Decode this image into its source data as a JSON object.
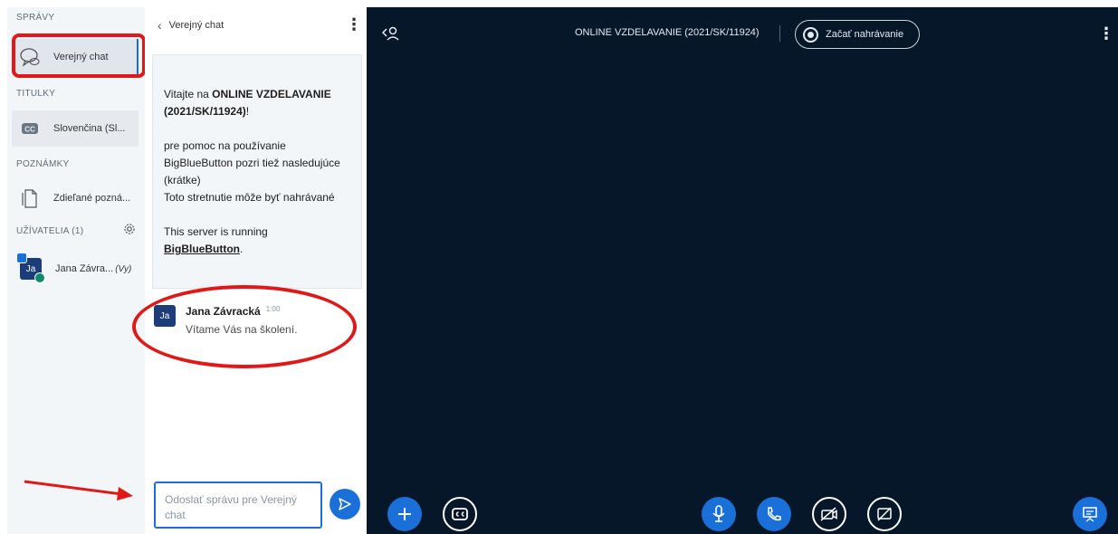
{
  "sidebar": {
    "sections": {
      "messages": "SPRÁVY",
      "captions": "TITULKY",
      "notes": "POZNÁMKY",
      "users": "UŽÍVATELIA (1)"
    },
    "public_chat_label": "Verejný chat",
    "captions_item_label": "Slovenčina (Sl...",
    "notes_item_label": "Zdieľané pozná...",
    "user": {
      "initials": "Ja",
      "name": "Jana Závra...",
      "you_tag": "(Vy)"
    }
  },
  "chat": {
    "header_title": "Verejný chat",
    "welcome": {
      "line1_prefix": "Vitajte na ",
      "meeting_name": "ONLINE VZDELAVANIE (2021/SK/11924)",
      "line1_suffix": "!",
      "help_text": "pre pomoc na používanie BigBlueButton pozri tiež nasledujúce (krátke)",
      "recording_note": "Toto stretnutie môže byť nahrávané",
      "server_text": "This server is running ",
      "server_link": "BigBlueButton",
      "server_suffix": "."
    },
    "messages": [
      {
        "initials": "Ja",
        "author": "Jana Závracká",
        "time": "1:00",
        "text": "Vítame Vás na školení."
      }
    ],
    "input_placeholder": "Odoslať správu pre Verejný chat"
  },
  "main": {
    "meeting_title": "ONLINE VZDELAVANIE (2021/SK/11924)",
    "record_label": "Začať nahrávanie"
  },
  "colors": {
    "accent": "#1b6fd8",
    "presentation_bg": "#06172a",
    "annotation_red": "#e01818"
  }
}
